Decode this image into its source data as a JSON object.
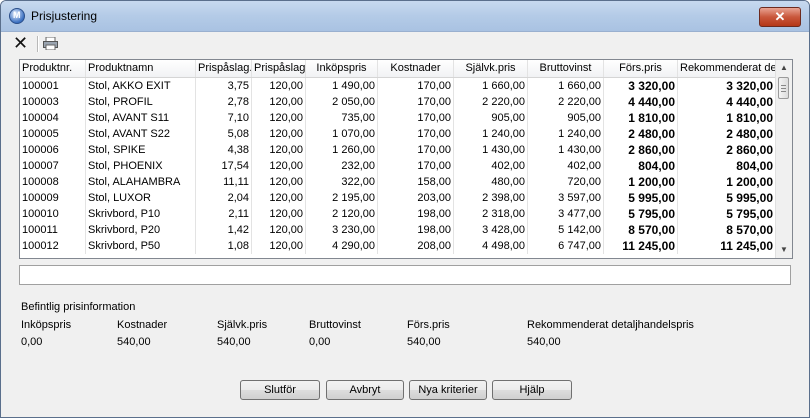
{
  "window": {
    "title": "Prisjustering",
    "close_label": "✕"
  },
  "toolbar": {
    "delete_icon": "x-icon",
    "print_icon": "print-icon"
  },
  "grid": {
    "columns": [
      "Produktnr.",
      "Produktnamn",
      "Prispåslag.",
      "Prispåslag",
      "Inköpspris",
      "Kostnader",
      "Självk.pris",
      "Bruttovinst",
      "Förs.pris",
      "Rekommenderat det"
    ],
    "rows": [
      [
        "100001",
        "Stol, AKKO EXIT",
        "3,75",
        "120,00",
        "1 490,00",
        "170,00",
        "1 660,00",
        "1 660,00",
        "3 320,00",
        "3 320,00"
      ],
      [
        "100003",
        "Stol, PROFIL",
        "2,78",
        "120,00",
        "2 050,00",
        "170,00",
        "2 220,00",
        "2 220,00",
        "4 440,00",
        "4 440,00"
      ],
      [
        "100004",
        "Stol, AVANT S11",
        "7,10",
        "120,00",
        "735,00",
        "170,00",
        "905,00",
        "905,00",
        "1 810,00",
        "1 810,00"
      ],
      [
        "100005",
        "Stol, AVANT S22",
        "5,08",
        "120,00",
        "1 070,00",
        "170,00",
        "1 240,00",
        "1 240,00",
        "2 480,00",
        "2 480,00"
      ],
      [
        "100006",
        "Stol, SPIKE",
        "4,38",
        "120,00",
        "1 260,00",
        "170,00",
        "1 430,00",
        "1 430,00",
        "2 860,00",
        "2 860,00"
      ],
      [
        "100007",
        "Stol, PHOENIX",
        "17,54",
        "120,00",
        "232,00",
        "170,00",
        "402,00",
        "402,00",
        "804,00",
        "804,00"
      ],
      [
        "100008",
        "Stol, ALAHAMBRA",
        "11,11",
        "120,00",
        "322,00",
        "158,00",
        "480,00",
        "720,00",
        "1 200,00",
        "1 200,00"
      ],
      [
        "100009",
        "Stol, LUXOR",
        "2,04",
        "120,00",
        "2 195,00",
        "203,00",
        "2 398,00",
        "3 597,00",
        "5 995,00",
        "5 995,00"
      ],
      [
        "100010",
        "Skrivbord, P10",
        "2,11",
        "120,00",
        "2 120,00",
        "198,00",
        "2 318,00",
        "3 477,00",
        "5 795,00",
        "5 795,00"
      ],
      [
        "100011",
        "Skrivbord, P20",
        "1,42",
        "120,00",
        "3 230,00",
        "198,00",
        "3 428,00",
        "5 142,00",
        "8 570,00",
        "8 570,00"
      ],
      [
        "100012",
        "Skrivbord, P50",
        "1,08",
        "120,00",
        "4 290,00",
        "208,00",
        "4 498,00",
        "6 747,00",
        "11 245,00",
        "11 245,00"
      ]
    ]
  },
  "info": {
    "heading": "Befintlig prisinformation",
    "labels": [
      "Inköpspris",
      "Kostnader",
      "Självk.pris",
      "Bruttovinst",
      "Förs.pris",
      "Rekommenderat detaljhandelspris"
    ],
    "values": [
      "0,00",
      "540,00",
      "540,00",
      "0,00",
      "540,00",
      "540,00"
    ]
  },
  "buttons": {
    "finish": "Slutför",
    "cancel": "Avbryt",
    "new_criteria": "Nya kriterier",
    "help": "Hjälp"
  },
  "colors": {
    "title_bg": "#b9cfe9",
    "close_bg": "#c9573c"
  }
}
